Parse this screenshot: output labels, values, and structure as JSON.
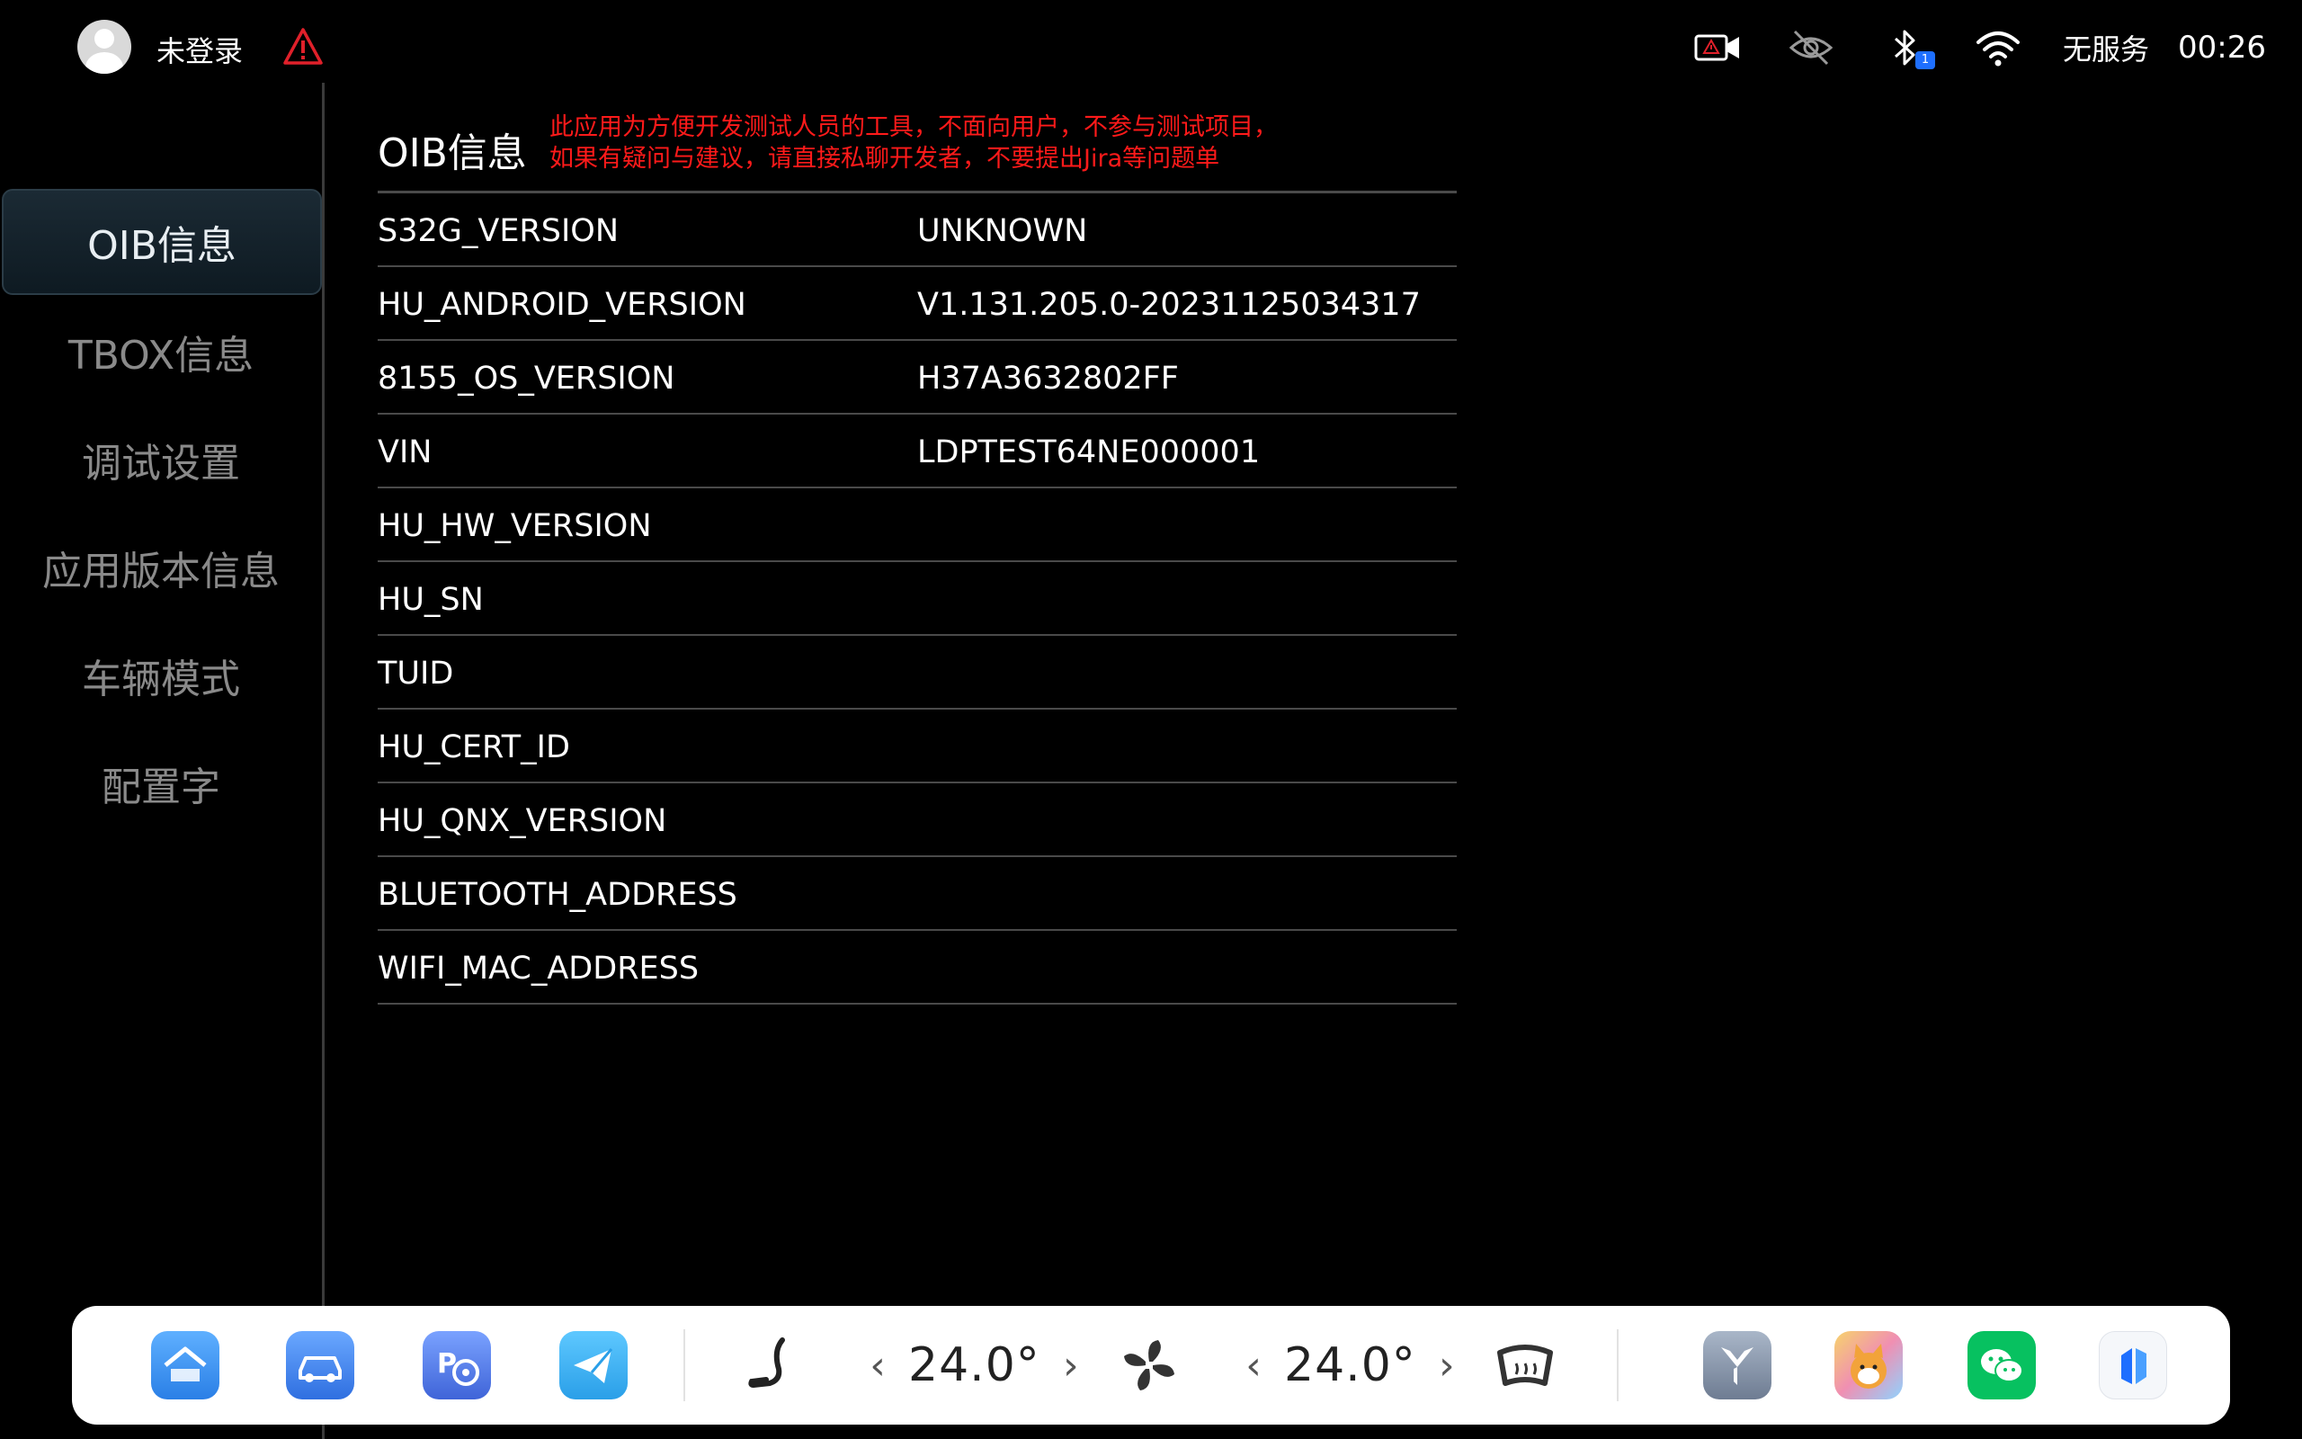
{
  "status": {
    "login_text": "未登录",
    "no_service": "无服务",
    "time": "00:26",
    "bt_badge": "1"
  },
  "sidebar": {
    "items": [
      {
        "label": "OIB信息",
        "active": true
      },
      {
        "label": "TBOX信息",
        "active": false
      },
      {
        "label": "调试设置",
        "active": false
      },
      {
        "label": "应用版本信息",
        "active": false
      },
      {
        "label": "车辆模式",
        "active": false
      },
      {
        "label": "配置字",
        "active": false
      }
    ]
  },
  "main": {
    "title": "OIB信息",
    "notice_line1": "此应用为方便开发测试人员的工具，不面向用户，不参与测试项目，",
    "notice_line2": "如果有疑问与建议，请直接私聊开发者，不要提出Jira等问题单",
    "rows": [
      {
        "key": "S32G_VERSION",
        "value": "UNKNOWN"
      },
      {
        "key": "HU_ANDROID_VERSION",
        "value": "V1.131.205.0-20231125034317"
      },
      {
        "key": "8155_OS_VERSION",
        "value": "H37A3632802FF"
      },
      {
        "key": "VIN",
        "value": "LDPTEST64NE000001"
      },
      {
        "key": "HU_HW_VERSION",
        "value": ""
      },
      {
        "key": "HU_SN",
        "value": ""
      },
      {
        "key": "TUID",
        "value": ""
      },
      {
        "key": "HU_CERT_ID",
        "value": ""
      },
      {
        "key": "HU_QNX_VERSION",
        "value": ""
      },
      {
        "key": "BLUETOOTH_ADDRESS",
        "value": ""
      },
      {
        "key": "WIFI_MAC_ADDRESS",
        "value": ""
      }
    ]
  },
  "dock": {
    "left_temp": "24.0°",
    "right_temp": "24.0°",
    "chev_left": "‹",
    "chev_right": "›",
    "apps": [
      "home-app-icon",
      "car-app-icon",
      "parking-app-icon",
      "telegram-app-icon",
      "brand-app-icon",
      "shiba-game-app-icon",
      "wechat-app-icon",
      "dual-app-icon"
    ]
  },
  "colors": {
    "notice": "#ff1a1a",
    "accent_blue": "#1e6fff",
    "wechat_green": "#07c160"
  }
}
